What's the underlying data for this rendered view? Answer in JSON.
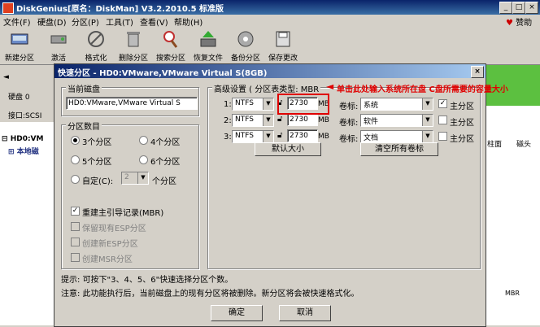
{
  "window": {
    "title": "DiskGenius[原名：DiskMan] V3.2.2010.5 标准版",
    "help_label": "赞助"
  },
  "menu": [
    "文件(F)",
    "硬盘(D)",
    "分区(P)",
    "工具(T)",
    "查看(V)",
    "帮助(H)"
  ],
  "toolbar": [
    "新建分区",
    "激活",
    "格式化",
    "删除分区",
    "搜索分区",
    "恢复文件",
    "备份分区",
    "保存更改"
  ],
  "left_panel": {
    "disk_label": "硬盘 0",
    "interface_label": "接口:SCSI",
    "tree_items": [
      "HD0:VM",
      "本地磁"
    ]
  },
  "right_panel": {
    "header": [
      "柱面",
      "磁头"
    ],
    "status": "MBR"
  },
  "dialog": {
    "title": "快速分区 - HD0:VMware,VMware Virtual S(8GB)",
    "current_disk_label": "当前磁盘",
    "current_disk_value": "HD0:VMware,VMware Virtual S",
    "count_group_label": "分区数目",
    "radios": [
      {
        "label": "3个分区",
        "checked": true
      },
      {
        "label": "4个分区",
        "checked": false
      },
      {
        "label": "5个分区",
        "checked": false
      },
      {
        "label": "6个分区",
        "checked": false
      }
    ],
    "custom_label": "自定(C):",
    "custom_value": "2",
    "custom_suffix": "个分区",
    "checks": [
      {
        "label": "重建主引导记录(MBR)",
        "checked": true,
        "enabled": true
      },
      {
        "label": "保留现有ESP分区",
        "checked": false,
        "enabled": false
      },
      {
        "label": "创建新ESP分区",
        "checked": false,
        "enabled": false
      },
      {
        "label": "创建MSR分区",
        "checked": false,
        "enabled": false
      }
    ],
    "advanced_label": "高级设置 ( 分区表类型: MBR",
    "volume_label_text": "卷标:",
    "primary_label": "主分区",
    "size_unit": "MB",
    "rows": [
      {
        "index": "1:",
        "fs": "NTFS",
        "size": "2730",
        "label": "系统",
        "primary": true
      },
      {
        "index": "2:",
        "fs": "NTFS",
        "size": "2730",
        "label": "软件",
        "primary": false
      },
      {
        "index": "3:",
        "fs": "NTFS",
        "size": "2730",
        "label": "文档",
        "primary": false
      }
    ],
    "default_size_btn": "默认大小",
    "clear_labels_btn": "清空所有卷标",
    "hint1": "提示: 可按下\"3、4、5、6\"快速选择分区个数。",
    "hint2": "注意: 此功能执行后，当前磁盘上的现有分区将被删除。新分区将会被快速格式化。",
    "ok_btn": "确定",
    "cancel_btn": "取消"
  },
  "annotation": "单击此处输入系统所在盘 C盘所需要的容量大小"
}
